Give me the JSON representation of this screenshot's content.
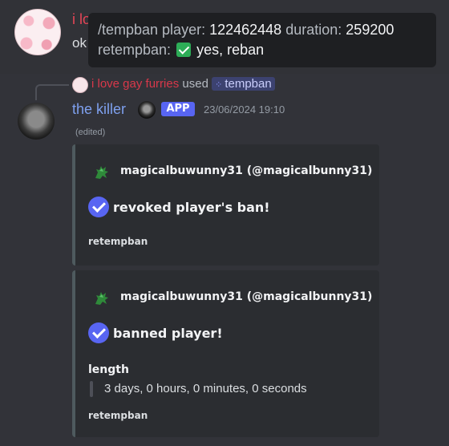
{
  "previous_message": {
    "author": "i love gay furries",
    "content": "ok"
  },
  "tooltip": {
    "line1_label": "/tempban player:",
    "line1_player": "122462448",
    "line1_duration_label": "duration:",
    "line1_duration": "259200",
    "line2_label": "retempban:",
    "line2_value": "yes, reban"
  },
  "command": {
    "user": "i love gay furries",
    "used": "used",
    "name": "tempban"
  },
  "bot_message": {
    "name": "the killer",
    "badge": "APP",
    "timestamp": "23/06/2024 19:10",
    "edited": "(edited)"
  },
  "embeds": [
    {
      "author": "magicalbuwunny31 (@magicalbunny31)",
      "title": "revoked player's ban!",
      "footer": "retempban"
    },
    {
      "author": "magicalbuwunny31 (@magicalbunny31)",
      "title": "banned player!",
      "field_name": "length",
      "field_value": "3 days, 0 hours, 0 minutes, 0 seconds",
      "footer": "retempban"
    }
  ],
  "colors": {
    "background": "#323339",
    "username_red": "#e64556",
    "bot_name": "#7ea0ee",
    "app_badge": "#5865f2",
    "embed_bg": "#2b2d31",
    "embed_border": "#4e5a5e",
    "check_green": "#2dad57"
  },
  "icons": [
    "flower-avatar-icon",
    "check-box-icon",
    "slash-command-icon",
    "troll-face-avatar-icon",
    "dragon-author-icon",
    "check-circle-icon"
  ]
}
